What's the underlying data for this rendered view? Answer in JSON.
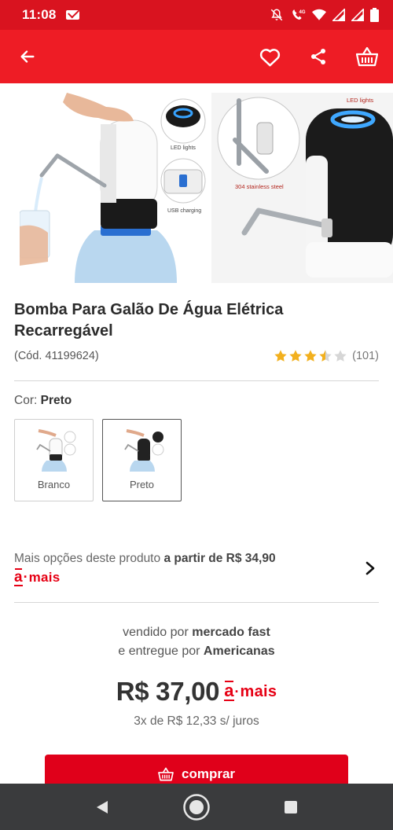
{
  "status_bar": {
    "time": "11:08",
    "icons": [
      "mail-icon",
      "mute-icon",
      "volte-4g-icon",
      "wifi-icon",
      "signal-icon",
      "signal-icon",
      "battery-icon"
    ]
  },
  "app_bar": {
    "back_icon": "arrow-left-icon",
    "actions": [
      "heart-icon",
      "share-icon",
      "basket-icon"
    ],
    "background": "#ee1c25"
  },
  "gallery": {
    "images": [
      {
        "labels": [
          "LED lights",
          "USB charging"
        ]
      },
      {
        "labels": [
          "LED lights",
          "304 stainless steel"
        ]
      }
    ]
  },
  "product": {
    "title": "Bomba Para Galão De Água Elétrica Recarregável",
    "code": "(Cód. 41199624)",
    "rating": 3.5,
    "reviews_count": "(101)"
  },
  "color": {
    "label": "Cor:",
    "selected": "Preto",
    "options": [
      {
        "label": "Branco",
        "selected": false
      },
      {
        "label": "Preto",
        "selected": true
      }
    ]
  },
  "more_options": {
    "prefix": "Mais opções deste produto",
    "highlight": "a partir de R$ 34,90",
    "badge_a": "a",
    "badge_dot": "·",
    "badge_mais": "mais"
  },
  "seller": {
    "sold_by_prefix": "vendido por",
    "sold_by": "mercado fast",
    "delivered_prefix": "e entregue por",
    "delivered_by": "Americanas"
  },
  "pricing": {
    "price": "R$ 37,00",
    "installments": "3x de R$ 12,33 s/ juros"
  },
  "buy_button": {
    "label": "comprar",
    "color": "#e0001a"
  },
  "nav_bar": {
    "buttons": [
      "back-triangle-icon",
      "home-circle-icon",
      "recents-square-icon"
    ]
  }
}
